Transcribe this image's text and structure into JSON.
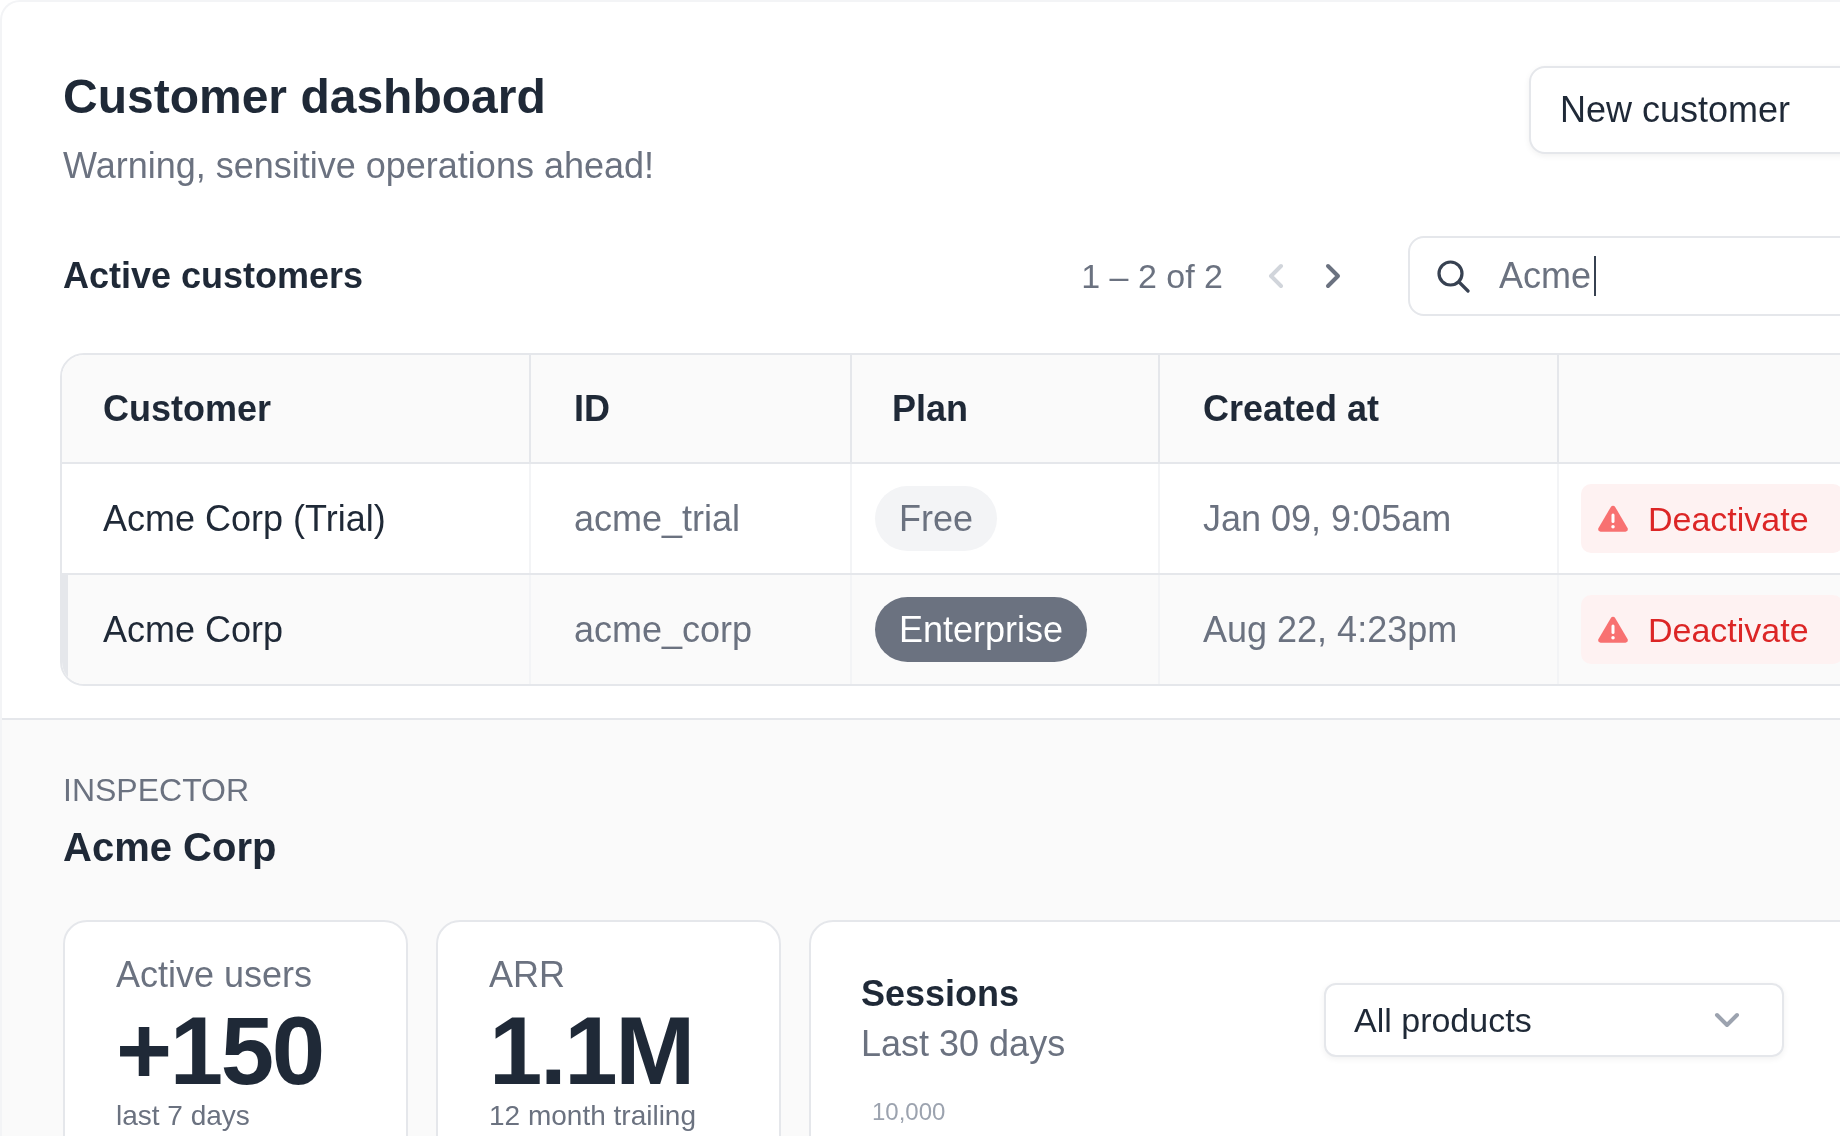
{
  "header": {
    "title": "Customer dashboard",
    "subtitle": "Warning, sensitive operations ahead!",
    "new_button": "New customer"
  },
  "customers": {
    "title": "Active customers",
    "pagination": {
      "range": "1 – 2 of 2",
      "previous": {
        "disabled": true
      },
      "next": {
        "disabled": false
      }
    },
    "search": {
      "value": "Acme",
      "focused": true
    },
    "table": {
      "columns": [
        "Customer",
        "ID",
        "Plan",
        "Created at"
      ],
      "rows": [
        {
          "customer": "Acme Corp (Trial)",
          "id": "acme_trial",
          "plan": {
            "label": "Free",
            "color": "#f3f4f6"
          },
          "created_at": "Jan 09, 9:05am",
          "action": "Deactivate",
          "selected": false
        },
        {
          "customer": "Acme Corp",
          "id": "acme_corp",
          "plan": {
            "label": "Enterprise",
            "color": "#6b7280"
          },
          "created_at": "Aug 22, 4:23pm",
          "action": "Deactivate",
          "selected": true
        }
      ]
    }
  },
  "inspector": {
    "label": "INSPECTOR",
    "title": "Acme Corp",
    "stats": [
      {
        "label": "Active users",
        "value": "+150",
        "note": "last 7 days"
      },
      {
        "label": "ARR",
        "value": "1.1M",
        "note": "12 month trailing"
      }
    ],
    "sessions": {
      "title": "Sessions",
      "subtitle": "Last 30 days",
      "filter": "All products",
      "axis_tick": "10,000"
    }
  }
}
